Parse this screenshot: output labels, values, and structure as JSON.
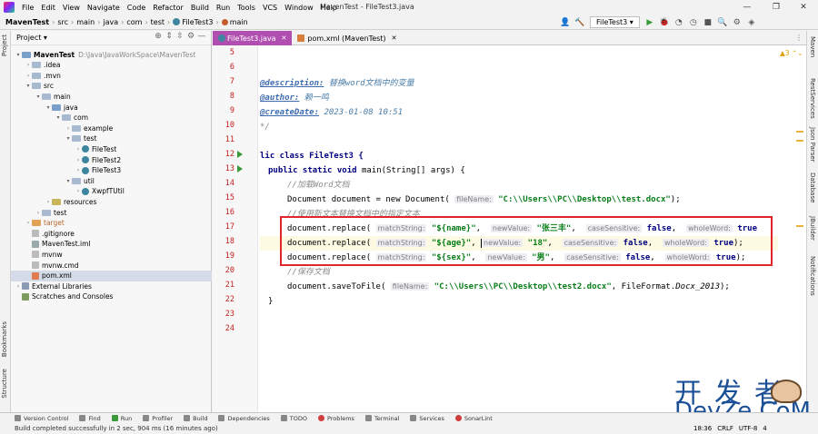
{
  "menu": [
    "File",
    "Edit",
    "View",
    "Navigate",
    "Code",
    "Refactor",
    "Build",
    "Run",
    "Tools",
    "VCS",
    "Window",
    "Help"
  ],
  "window_title": "MavenTest - FileTest3.java",
  "breadcrumb": [
    "MavenTest",
    "src",
    "main",
    "java",
    "com",
    "test",
    "FileTest3",
    "main"
  ],
  "toolbar": {
    "run_config": "FileTest3"
  },
  "left_tabs": [
    "Project",
    "Bookmarks",
    "Structure"
  ],
  "right_tabs": [
    "Maven",
    "RestServices",
    "Json Parser",
    "Database",
    "JBuilder",
    "Notifications"
  ],
  "project_panel": {
    "title": "Project",
    "tree": [
      {
        "name": "MavenTest",
        "extra": "D:\\Java\\JavaWorkSpace\\MavenTest",
        "type": "folder-src",
        "depth": 0,
        "open": true
      },
      {
        "name": ".idea",
        "type": "folder",
        "depth": 1,
        "open": false
      },
      {
        "name": ".mvn",
        "type": "folder",
        "depth": 1,
        "open": false
      },
      {
        "name": "src",
        "type": "folder",
        "depth": 1,
        "open": true
      },
      {
        "name": "main",
        "type": "folder",
        "depth": 2,
        "open": true
      },
      {
        "name": "java",
        "type": "folder-src",
        "depth": 3,
        "open": true
      },
      {
        "name": "com",
        "type": "folder",
        "depth": 4,
        "open": true
      },
      {
        "name": "example",
        "type": "folder",
        "depth": 5,
        "open": false
      },
      {
        "name": "test",
        "type": "folder",
        "depth": 5,
        "open": true
      },
      {
        "name": "FileTest",
        "type": "java",
        "depth": 6,
        "open": false
      },
      {
        "name": "FileTest2",
        "type": "java",
        "depth": 6,
        "open": false
      },
      {
        "name": "FileTest3",
        "type": "java",
        "depth": 6,
        "open": false
      },
      {
        "name": "util",
        "type": "folder",
        "depth": 5,
        "open": true
      },
      {
        "name": "XwpfTUtil",
        "type": "java",
        "depth": 6,
        "open": false
      },
      {
        "name": "resources",
        "type": "folder-yellow",
        "depth": 3,
        "open": false
      },
      {
        "name": "test",
        "type": "folder",
        "depth": 2,
        "open": false
      },
      {
        "name": "target",
        "type": "folder-orange",
        "depth": 1,
        "open": false
      },
      {
        "name": ".gitignore",
        "type": "txt",
        "depth": 1,
        "leaf": true
      },
      {
        "name": "MavenTest.iml",
        "type": "iml",
        "depth": 1,
        "leaf": true
      },
      {
        "name": "mvnw",
        "type": "txt",
        "depth": 1,
        "leaf": true
      },
      {
        "name": "mvnw.cmd",
        "type": "txt",
        "depth": 1,
        "leaf": true
      },
      {
        "name": "pom.xml",
        "type": "xml",
        "depth": 1,
        "leaf": true,
        "selected": true
      },
      {
        "name": "External Libraries",
        "type": "lib",
        "depth": 0,
        "open": false
      },
      {
        "name": "Scratches and Consoles",
        "type": "scr",
        "depth": 0,
        "leaf": true
      }
    ]
  },
  "tabs": [
    {
      "label": "FileTest3.java",
      "active": true
    },
    {
      "label": "pom.xml (MavenTest)",
      "active": false
    }
  ],
  "editor": {
    "line_numbers": [
      "5",
      "6",
      "7",
      "8",
      "9",
      "10",
      "11",
      "12",
      "13",
      "14",
      "15",
      "16",
      "17",
      "18",
      "19",
      "20",
      "21",
      "22",
      "23",
      "24"
    ],
    "warnings": "3",
    "lines": {
      "l7_tag": "@description:",
      "l7_val": "替换word文档中的变量",
      "l8_tag": "@author:",
      "l8_val": "赖一鸣",
      "l9_tag": "@createDate:",
      "l9_val": "2023-01-08 10:51",
      "l10": "*/",
      "l12_a": "lic class FileTest3 {",
      "l13_kw": "public static void",
      "l13_rest": "main(String[] args) {",
      "l14": "//加载Word文档",
      "l15_a": "Document document = new Document(",
      "l15_hint": "fileName:",
      "l15_str": "\"C:\\\\Users\\\\PC\\\\Desktop\\\\test.docx\"",
      "l15_end": ");",
      "l16": "//使用新文本替换文档中的指定文本",
      "l17": {
        "call": "document.replace(",
        "h1": "matchString:",
        "s1": "\"${name}\"",
        "h2": "newValue:",
        "s2": "\"张三丰\"",
        "h3": "caseSensitive:",
        "v3": "false",
        "h4": "wholeWord:",
        "v4": "true"
      },
      "l18": {
        "call": "document.replace(",
        "h1": "matchString:",
        "s1": "\"${age}\"",
        "h2": "newValue:",
        "s2": "\"18\"",
        "h3": "caseSensitive:",
        "v3": "false",
        "h4": "wholeWord:",
        "v4": "true"
      },
      "l19": {
        "call": "document.replace(",
        "h1": "matchString:",
        "s1": "\"${sex}\"",
        "h2": "newValue:",
        "s2": "\"男\"",
        "h3": "caseSensitive:",
        "v3": "false",
        "h4": "wholeWord:",
        "v4": "true"
      },
      "l20": "//保存文档",
      "l21_a": "document.saveToFile(",
      "l21_hint": "fileName:",
      "l21_str": "\"C:\\\\Users\\\\PC\\\\Desktop\\\\test2.docx\"",
      "l21_b": ", FileFormat.",
      "l21_c": "Docx_2013",
      "l21_end": ");",
      "l22": "}"
    }
  },
  "tool_windows": [
    "Version Control",
    "Find",
    "Run",
    "Profiler",
    "Build",
    "Dependencies",
    "TODO",
    "Problems",
    "Terminal",
    "Services",
    "SonarLint"
  ],
  "status": {
    "message": "Build completed successfully in 2 sec, 904 ms (16 minutes ago)",
    "position": "18:36",
    "line_sep": "CRLF",
    "encoding": "UTF-8",
    "indent": "4"
  },
  "watermark": {
    "line1": "开发者",
    "line2": "DevZe.CoM"
  }
}
